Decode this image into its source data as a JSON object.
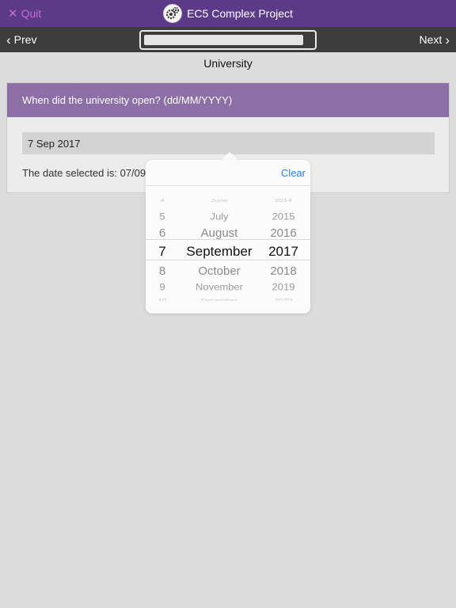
{
  "header": {
    "quit_label": "Quit",
    "app_title": "EC5 Complex Project",
    "logo_icon": "gears-icon"
  },
  "nav": {
    "prev_label": "Prev",
    "next_label": "Next",
    "progress_fraction": 0.95
  },
  "page": {
    "title": "University"
  },
  "question": {
    "text": "When did the university open? (dd/MM/YYYY)",
    "answer_value": "7 Sep 2017",
    "selected_text": "The date selected is: 07/09/2017"
  },
  "date_picker": {
    "clear_label": "Clear",
    "days": [
      "4",
      "5",
      "6",
      "7",
      "8",
      "9",
      "10"
    ],
    "months": [
      "June",
      "July",
      "August",
      "September",
      "October",
      "November",
      "December"
    ],
    "years": [
      "2014",
      "2015",
      "2016",
      "2017",
      "2018",
      "2019",
      "2020"
    ],
    "selected": {
      "day": "7",
      "month": "September",
      "year": "2017"
    }
  },
  "colors": {
    "header_bg": "#5b3a87",
    "quit_color": "#c86bd8",
    "question_bg": "#8c6fa6",
    "accent_link": "#2d7de0"
  }
}
